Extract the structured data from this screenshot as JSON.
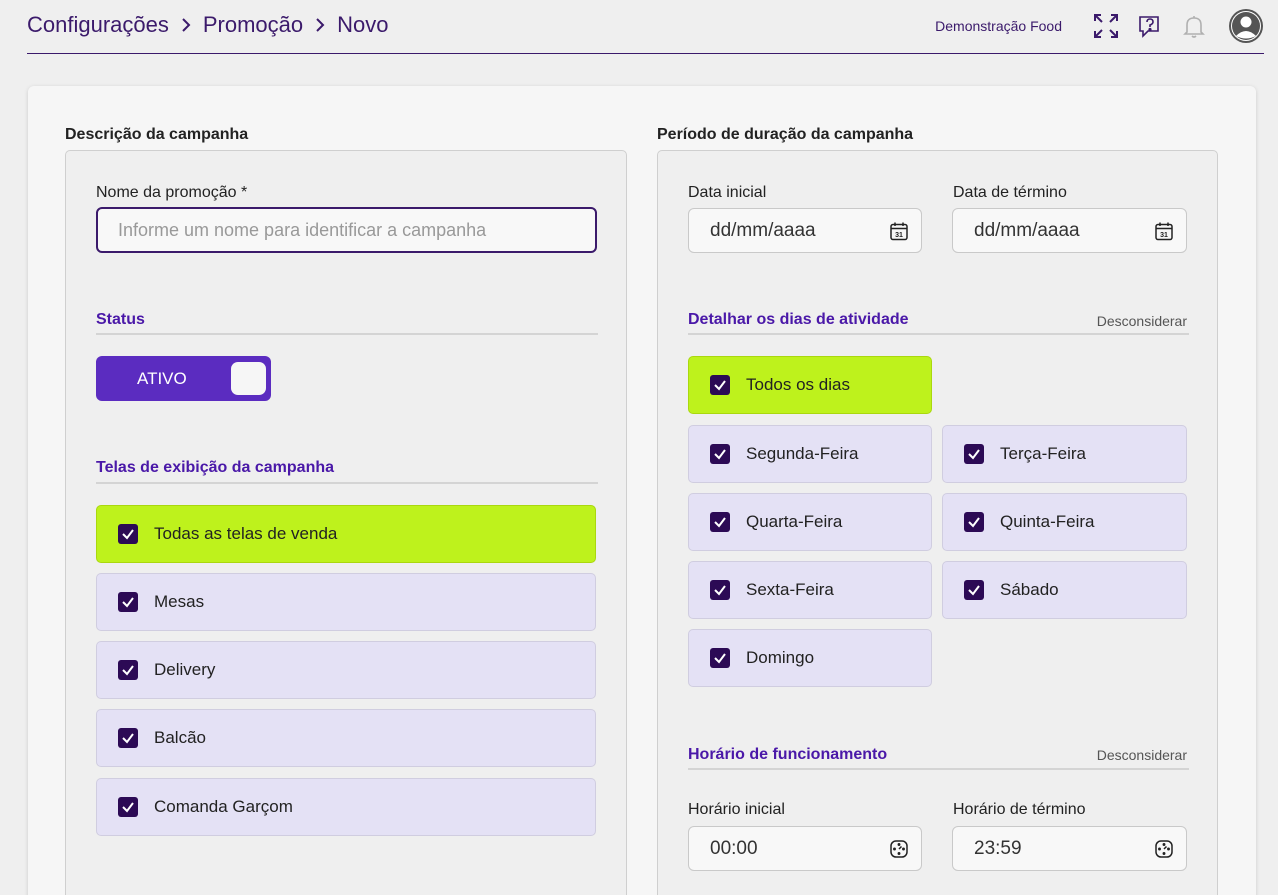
{
  "breadcrumb": [
    "Configurações",
    "Promoção",
    "Novo"
  ],
  "company": "Demonstração Food",
  "colors": {
    "accent": "#5b2cc0",
    "dark": "#3b1a6b",
    "highlight": "#bef21c",
    "option_bg": "#e4e1f5"
  },
  "left": {
    "title": "Descrição da campanha",
    "name_label": "Nome da promoção *",
    "name_placeholder": "Informe um nome para identificar a campanha",
    "status_title": "Status",
    "status_toggle": "ATIVO",
    "screens_title": "Telas de exibição da campanha",
    "screens": [
      "Todas as telas de venda",
      "Mesas",
      "Delivery",
      "Balcão",
      "Comanda Garçom"
    ]
  },
  "right": {
    "title": "Período de duração da campanha",
    "start_label": "Data inicial",
    "start_value": "dd/mm/aaaa",
    "end_label": "Data de término",
    "end_value": "dd/mm/aaaa",
    "days_title": "Detalhar os dias de atividade",
    "days_link": "Desconsiderar",
    "all_days": "Todos os dias",
    "days": [
      "Segunda-Feira",
      "Terça-Feira",
      "Quarta-Feira",
      "Quinta-Feira",
      "Sexta-Feira",
      "Sábado",
      "Domingo"
    ],
    "hours_title": "Horário de funcionamento",
    "hours_link": "Desconsiderar",
    "hour_start_label": "Horário inicial",
    "hour_start_value": "00:00",
    "hour_end_label": "Horário de término",
    "hour_end_value": "23:59"
  }
}
